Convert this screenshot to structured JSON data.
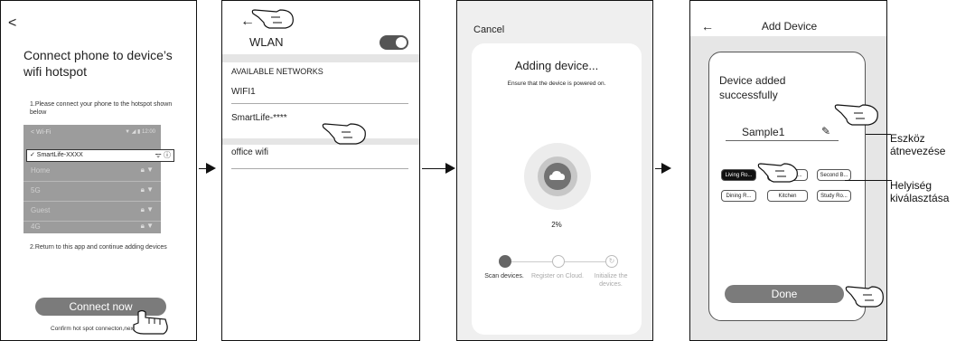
{
  "screen1": {
    "back_glyph": "<",
    "title": "Connect phone to device’s wifi hotspot",
    "step1": "1.Please connect your phone to the hotspot shown below",
    "fake_header": "< Wi-Fi",
    "fake_status": "▼ ◢ ▮ 12:00",
    "selected_network": "✓ SmartLife-XXXX",
    "fake_networks": [
      "Home",
      "5G",
      "Guest",
      "4G"
    ],
    "step2": "2.Return to this app and continue adding devices",
    "connect_button": "Connect now",
    "footnote": "Confirm hot spot connecton,next"
  },
  "screen2": {
    "back_glyph": "←",
    "title": "WLAN",
    "section_label": "AVAILABLE NETWORKS",
    "networks": [
      "WIFI1",
      "SmartLife-****",
      "office wifi"
    ]
  },
  "screen3": {
    "cancel": "Cancel",
    "title": "Adding device...",
    "subtitle": "Ensure that the device is powered on.",
    "progress_text": "2%",
    "progress": 0.02,
    "steps": [
      {
        "label": "Scan devices."
      },
      {
        "label": "Register on Cloud."
      },
      {
        "label": "Initialize the devices."
      }
    ]
  },
  "screen4": {
    "back_glyph": "←",
    "title": "Add Device",
    "success_text": "Device added successfully",
    "device_name": "Sample1",
    "rooms": [
      "Living Ro...",
      "Master Be...",
      "Second B...",
      "Dining R...",
      "Kitchen",
      "Study Ro..."
    ],
    "active_room": "Living Ro...",
    "done_button": "Done"
  },
  "callouts": {
    "rename": "Eszköz átnevezése",
    "room": "Helyiség kiválasztása"
  },
  "colors": {
    "button_gray": "#7b7b7b",
    "active_chip": "#111111",
    "screen3_bg": "#efefef"
  }
}
